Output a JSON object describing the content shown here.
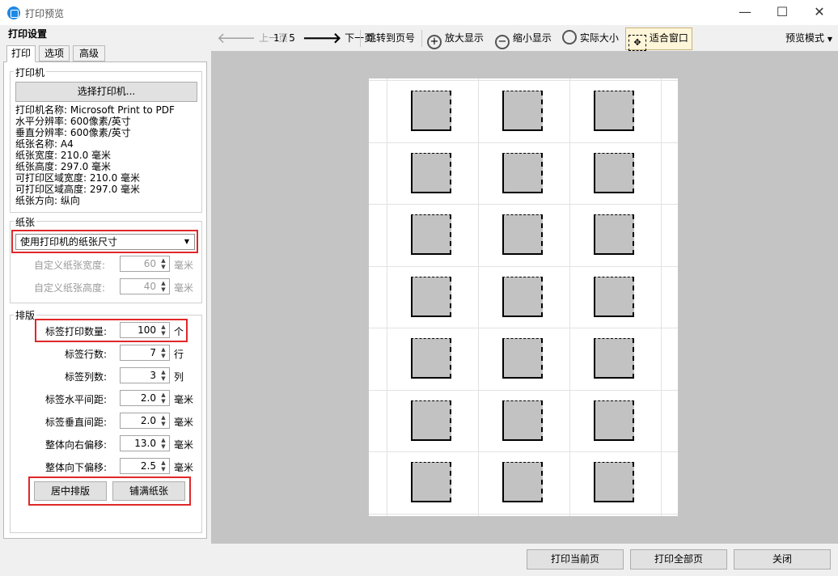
{
  "window": {
    "title": "打印预览",
    "minimize_glyph": "—",
    "maximize_glyph": "☐",
    "close_glyph": "✕"
  },
  "left_panel": {
    "header": "打印设置",
    "tabs": [
      "打印",
      "选项",
      "高级"
    ],
    "printer": {
      "group_label": "打印机",
      "select_button": "选择打印机...",
      "info": [
        "打印机名称: Microsoft Print to PDF",
        "水平分辨率: 600像素/英寸",
        "垂直分辨率: 600像素/英寸",
        "纸张名称: A4",
        "纸张宽度: 210.0 毫米",
        "纸张高度: 297.0 毫米",
        "可打印区域宽度: 210.0 毫米",
        "可打印区域高度: 297.0 毫米",
        "纸张方向: 纵向"
      ]
    },
    "paper": {
      "group_label": "纸张",
      "size_select": "使用打印机的纸张尺寸",
      "custom_width_label": "自定义纸张宽度:",
      "custom_width_value": "60",
      "custom_height_label": "自定义纸张高度:",
      "custom_height_value": "40",
      "unit_mm": "毫米"
    },
    "layout": {
      "group_label": "排版",
      "rows": [
        {
          "label": "标签打印数量:",
          "value": "100",
          "unit": "个"
        },
        {
          "label": "标签行数:",
          "value": "7",
          "unit": "行"
        },
        {
          "label": "标签列数:",
          "value": "3",
          "unit": "列"
        },
        {
          "label": "标签水平间距:",
          "value": "2.0",
          "unit": "毫米"
        },
        {
          "label": "标签垂直间距:",
          "value": "2.0",
          "unit": "毫米"
        },
        {
          "label": "整体向右偏移:",
          "value": "13.0",
          "unit": "毫米"
        },
        {
          "label": "整体向下偏移:",
          "value": "2.5",
          "unit": "毫米"
        }
      ],
      "center_button": "居中排版",
      "fill_button": "铺满纸张"
    }
  },
  "toolbar": {
    "prev_page": "上一页",
    "page_indicator": "1 / 5",
    "next_page": "下一页",
    "goto_page": "跳转到页号",
    "zoom_in": "放大显示",
    "zoom_out": "缩小显示",
    "actual_size": "实际大小",
    "fit_window": "适合窗口",
    "preview_mode": "预览模式"
  },
  "preview": {
    "rows": 7,
    "cols": 3
  },
  "footer": {
    "print_current": "打印当前页",
    "print_all": "打印全部页",
    "close": "关闭"
  }
}
